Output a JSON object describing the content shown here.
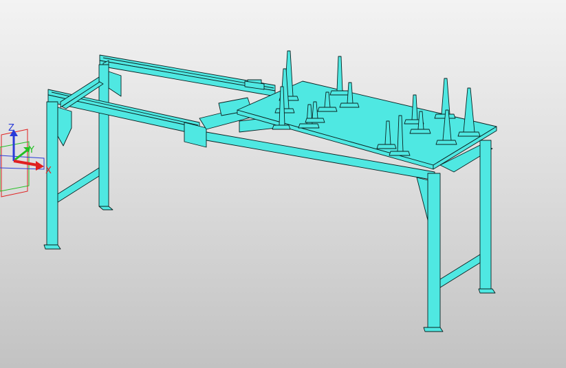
{
  "viewport": {
    "background_top": "#f3f3f3",
    "background_bottom": "#c2c2c2",
    "model_color": "#4fe8e2",
    "edge_color": "#0a1f1f"
  },
  "triad": {
    "z_label": "Z",
    "y_label": "Y",
    "x_label": "X",
    "z_color": "#2a3bd8",
    "y_color": "#22c022",
    "x_color": "#e02020"
  },
  "model": {
    "icon": "gantry-fixture-table-model"
  }
}
